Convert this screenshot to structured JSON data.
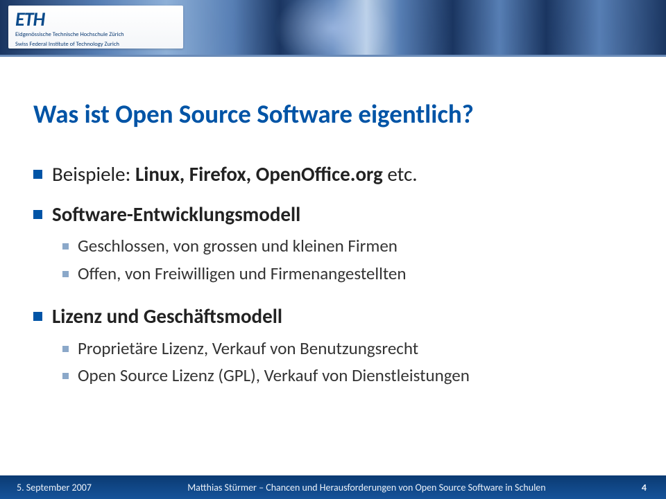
{
  "header": {
    "logo_text": "ETH",
    "sub_line1": "Eidgenössische Technische Hochschule Zürich",
    "sub_line2": "Swiss Federal Institute of Technology Zurich"
  },
  "title": "Was ist Open Source Software eigentlich?",
  "items": [
    {
      "label_plain": "Beispiele: ",
      "label_strong": "Linux, Firefox, OpenOffice.org",
      "label_after": " etc.",
      "sub": []
    },
    {
      "label_strong": "Software-Entwicklungsmodell",
      "sub": [
        "Geschlossen, von grossen und kleinen Firmen",
        "Offen, von Freiwilligen und Firmenangestellten"
      ]
    },
    {
      "label_strong": "Lizenz und Geschäftsmodell",
      "sub": [
        "Proprietäre Lizenz, Verkauf von Benutzungsrecht",
        "Open Source Lizenz (GPL), Verkauf von Dienstleistungen"
      ]
    }
  ],
  "footer": {
    "date": "5. September 2007",
    "center": "Matthias Stürmer – Chancen und Herausforderungen von Open Source Software in Schulen",
    "page": "4"
  }
}
